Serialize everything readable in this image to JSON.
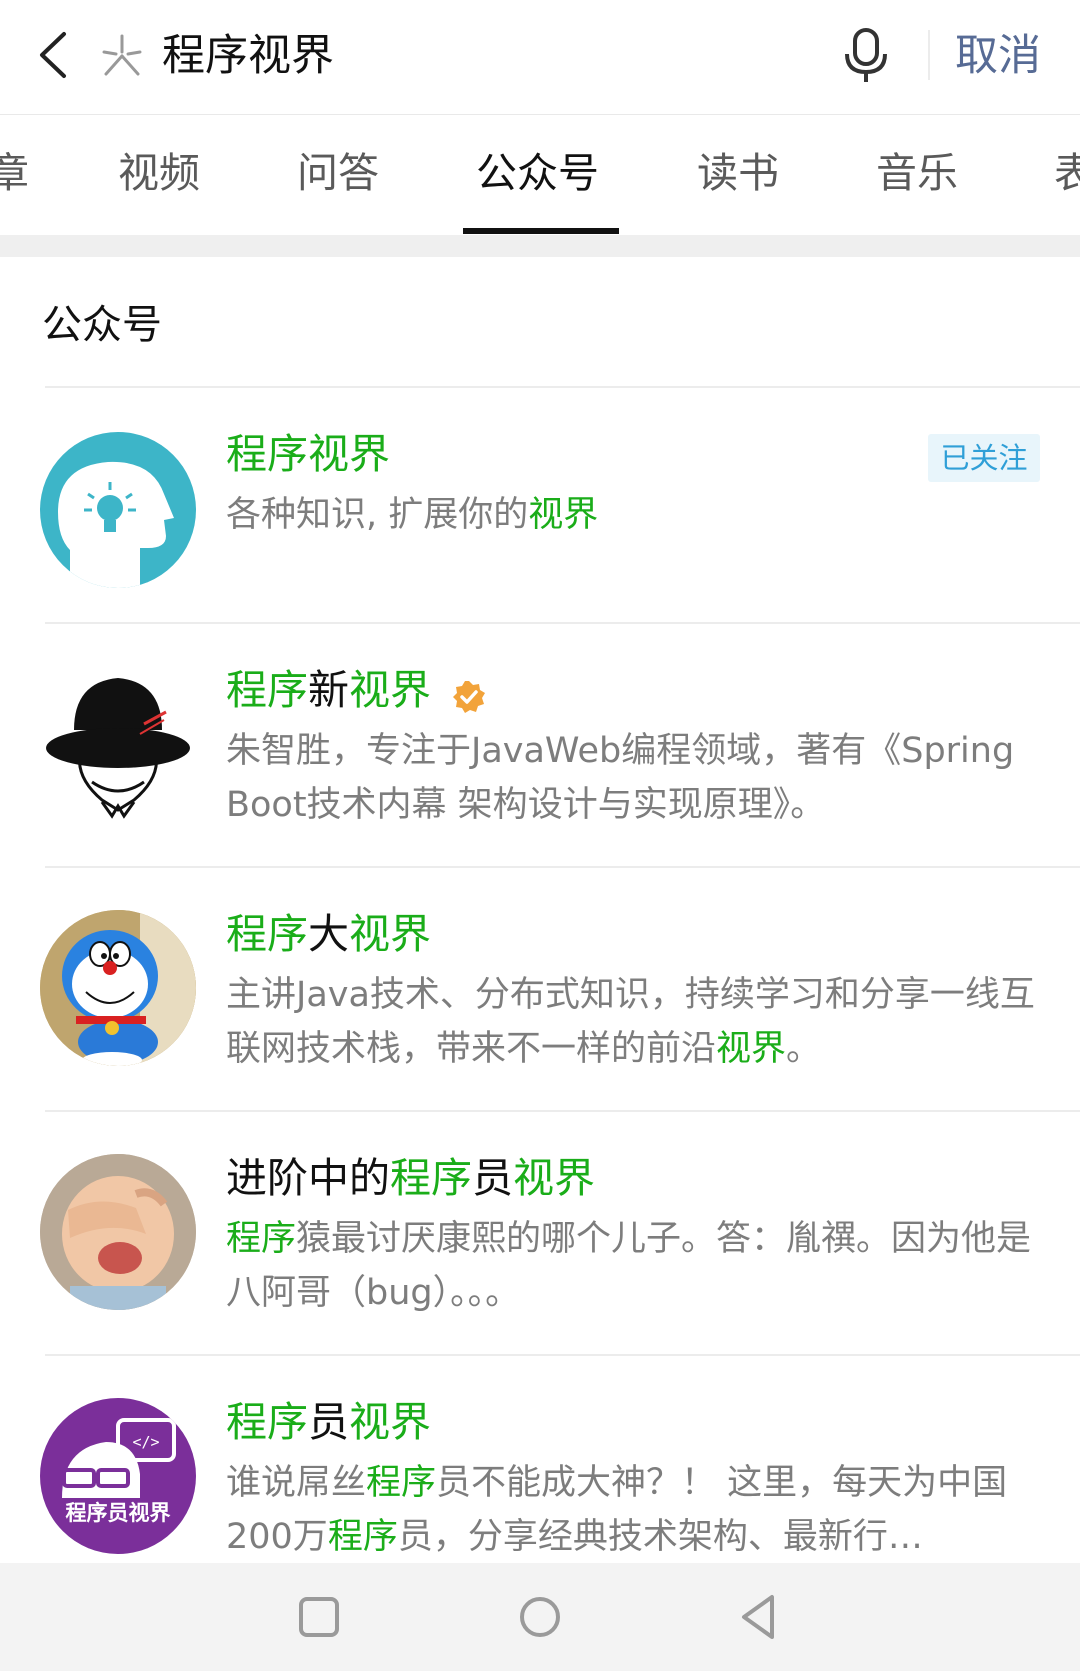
{
  "search": {
    "query": "程序视界",
    "cancel_label": "取消"
  },
  "tabs": [
    {
      "label": "章",
      "active": false
    },
    {
      "label": "视频",
      "active": false
    },
    {
      "label": "问答",
      "active": false
    },
    {
      "label": "公众号",
      "active": true
    },
    {
      "label": "读书",
      "active": false
    },
    {
      "label": "音乐",
      "active": false
    },
    {
      "label": "表",
      "active": false
    }
  ],
  "section": {
    "title": "公众号"
  },
  "accounts": [
    {
      "title": [
        {
          "t": "程序视界",
          "hl": true
        }
      ],
      "desc": [
        {
          "t": "各种知识, 扩展你的",
          "hl": false
        },
        {
          "t": "视界",
          "hl": true
        }
      ],
      "follow_label": "已关注",
      "verified": false,
      "avatar_icon": "lightbulb-head-icon"
    },
    {
      "title": [
        {
          "t": "程序",
          "hl": true
        },
        {
          "t": "新",
          "hl": false
        },
        {
          "t": "视界",
          "hl": true
        }
      ],
      "desc": [
        {
          "t": "朱智胜，专注于JavaWeb编程领域，著有《Spring Boot技术内幕 架构设计与实现原理》。",
          "hl": false
        }
      ],
      "verified": true,
      "avatar_icon": "bowler-hat-icon"
    },
    {
      "title": [
        {
          "t": "程序",
          "hl": true
        },
        {
          "t": "大",
          "hl": false
        },
        {
          "t": "视界",
          "hl": true
        }
      ],
      "desc": [
        {
          "t": "主讲Java技术、分布式知识，持续学习和分享一线互联网技术栈，带来不一样的前沿",
          "hl": false
        },
        {
          "t": "视界",
          "hl": true
        },
        {
          "t": "。",
          "hl": false
        }
      ],
      "verified": false,
      "avatar_icon": "doraemon-icon"
    },
    {
      "title": [
        {
          "t": "进阶中的",
          "hl": false
        },
        {
          "t": "程序",
          "hl": true
        },
        {
          "t": "员",
          "hl": false
        },
        {
          "t": "视界",
          "hl": true
        }
      ],
      "desc": [
        {
          "t": "程序",
          "hl": true
        },
        {
          "t": "猿最讨厌康熙的哪个儿子。答：胤禩。因为他是八阿哥（bug）。。。",
          "hl": false
        }
      ],
      "verified": false,
      "avatar_icon": "crying-baby-icon"
    },
    {
      "title": [
        {
          "t": "程序",
          "hl": true
        },
        {
          "t": "员",
          "hl": false
        },
        {
          "t": "视界",
          "hl": true
        }
      ],
      "desc": [
        {
          "t": "谁说屌丝",
          "hl": false
        },
        {
          "t": "程序",
          "hl": true
        },
        {
          "t": "员不能成大神？！ 这里，每天为中国200万",
          "hl": false
        },
        {
          "t": "程序",
          "hl": true
        },
        {
          "t": "员，分享经典技术架构、最新行…",
          "hl": false
        }
      ],
      "verified": false,
      "avatar_icon": "programmer-logo-icon",
      "avatar_text": "程序员视界",
      "avatar_code": "</>"
    }
  ],
  "colors": {
    "highlight": "#1aad19",
    "link": "#576b95",
    "desc": "#7d7d7d",
    "follow_bg": "#e8f5fb"
  }
}
